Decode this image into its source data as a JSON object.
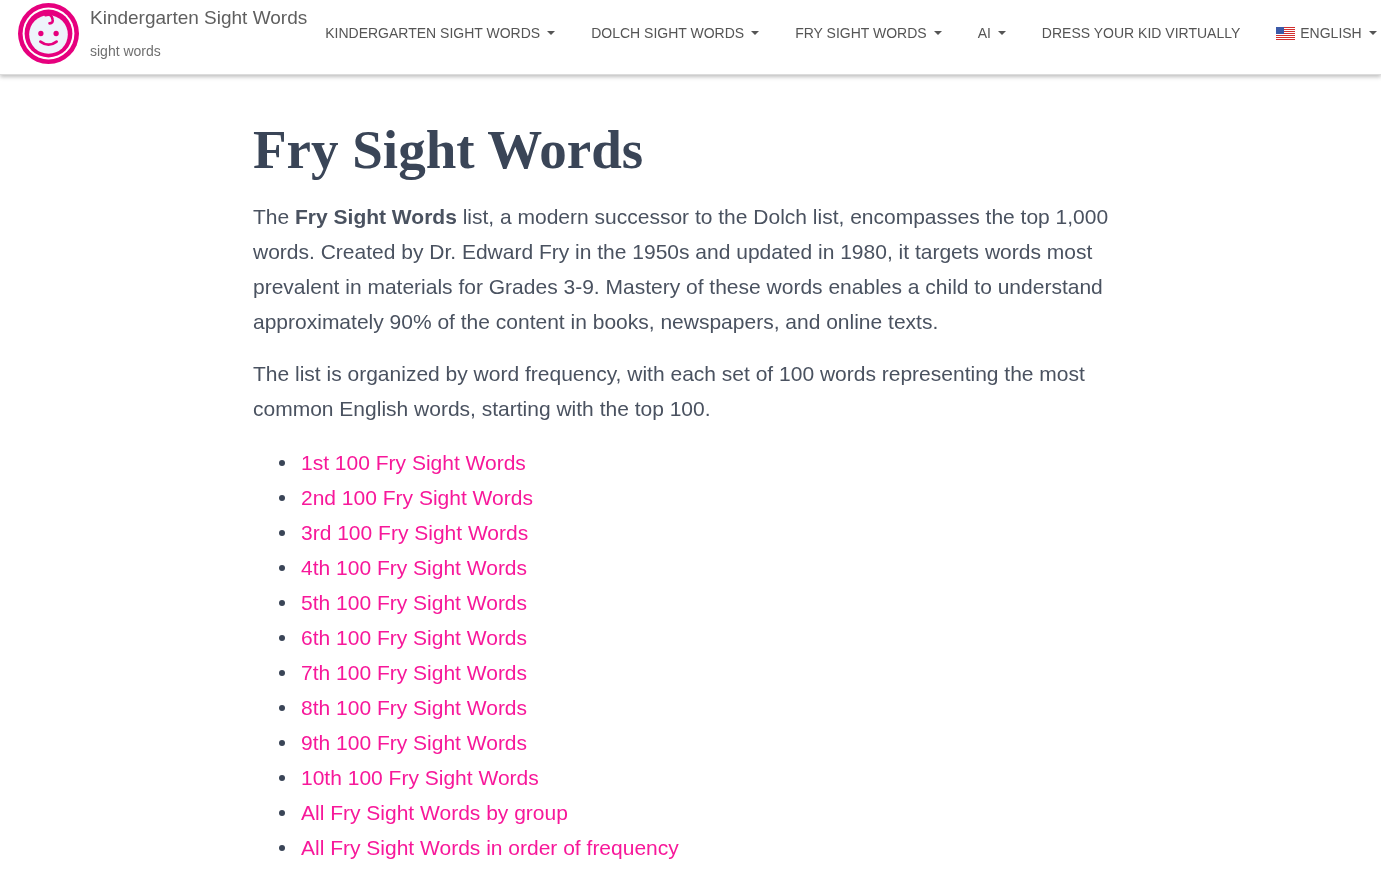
{
  "site": {
    "title": "Kindergarten Sight Words",
    "tagline": "sight words"
  },
  "nav": [
    {
      "label": "KINDERGARTEN SIGHT WORDS",
      "kind": "dropdown"
    },
    {
      "label": "DOLCH SIGHT WORDS",
      "kind": "dropdown"
    },
    {
      "label": "FRY SIGHT WORDS",
      "kind": "dropdown"
    },
    {
      "label": "AI",
      "kind": "dropdown"
    },
    {
      "label": "DRESS YOUR KID VIRTUALLY",
      "kind": "link"
    },
    {
      "label": "ENGLISH",
      "kind": "language"
    }
  ],
  "page": {
    "heading": "Fry Sight Words",
    "paragraphs": [
      "The **Fry Sight Words** list, a modern successor to the Dolch list, encompasses the top 1,000 words. Created by Dr. Edward Fry in the 1950s and updated in 1980, it targets words most prevalent in materials for Grades 3-9. Mastery of these words enables a child to understand approximately 90% of the content in books, newspapers, and online texts.",
      "The list is organized by word frequency, with each set of 100 words representing the most common English words, starting with the top 100."
    ],
    "links": [
      "1st 100 Fry Sight Words",
      "2nd 100 Fry Sight Words",
      "3rd 100 Fry Sight Words",
      "4th 100 Fry Sight Words",
      "5th 100 Fry Sight Words",
      "6th 100 Fry Sight Words",
      "7th 100 Fry Sight Words",
      "8th 100 Fry Sight Words",
      "9th 100 Fry Sight Words",
      "10th 100 Fry Sight Words",
      "All Fry Sight Words by group",
      "All Fry Sight Words in order of frequency"
    ]
  }
}
